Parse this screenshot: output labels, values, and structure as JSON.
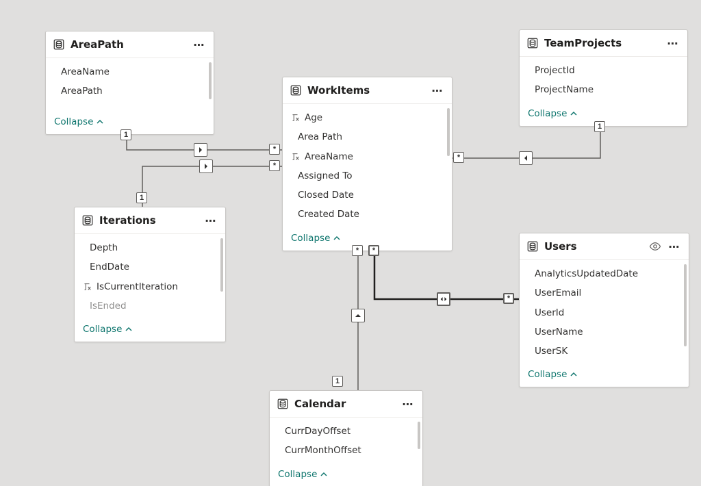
{
  "tables": {
    "areaPath": {
      "title": "AreaPath",
      "fields": [
        "AreaName",
        "AreaPath"
      ]
    },
    "iterations": {
      "title": "Iterations",
      "fields": [
        "Depth",
        "EndDate",
        "IsCurrentIteration",
        "IsEnded"
      ]
    },
    "workItems": {
      "title": "WorkItems",
      "fields": [
        "Age",
        "Area Path",
        "AreaName",
        "Assigned To",
        "Closed Date",
        "Created Date"
      ]
    },
    "teamProjects": {
      "title": "TeamProjects",
      "fields": [
        "ProjectId",
        "ProjectName"
      ]
    },
    "users": {
      "title": "Users",
      "fields": [
        "AnalyticsUpdatedDate",
        "UserEmail",
        "UserId",
        "UserName",
        "UserSK"
      ]
    },
    "calendar": {
      "title": "Calendar",
      "fields": [
        "CurrDayOffset",
        "CurrMonthOffset"
      ]
    }
  },
  "collapseLabel": "Collapse",
  "cardinality": {
    "one": "1",
    "many": "*"
  }
}
